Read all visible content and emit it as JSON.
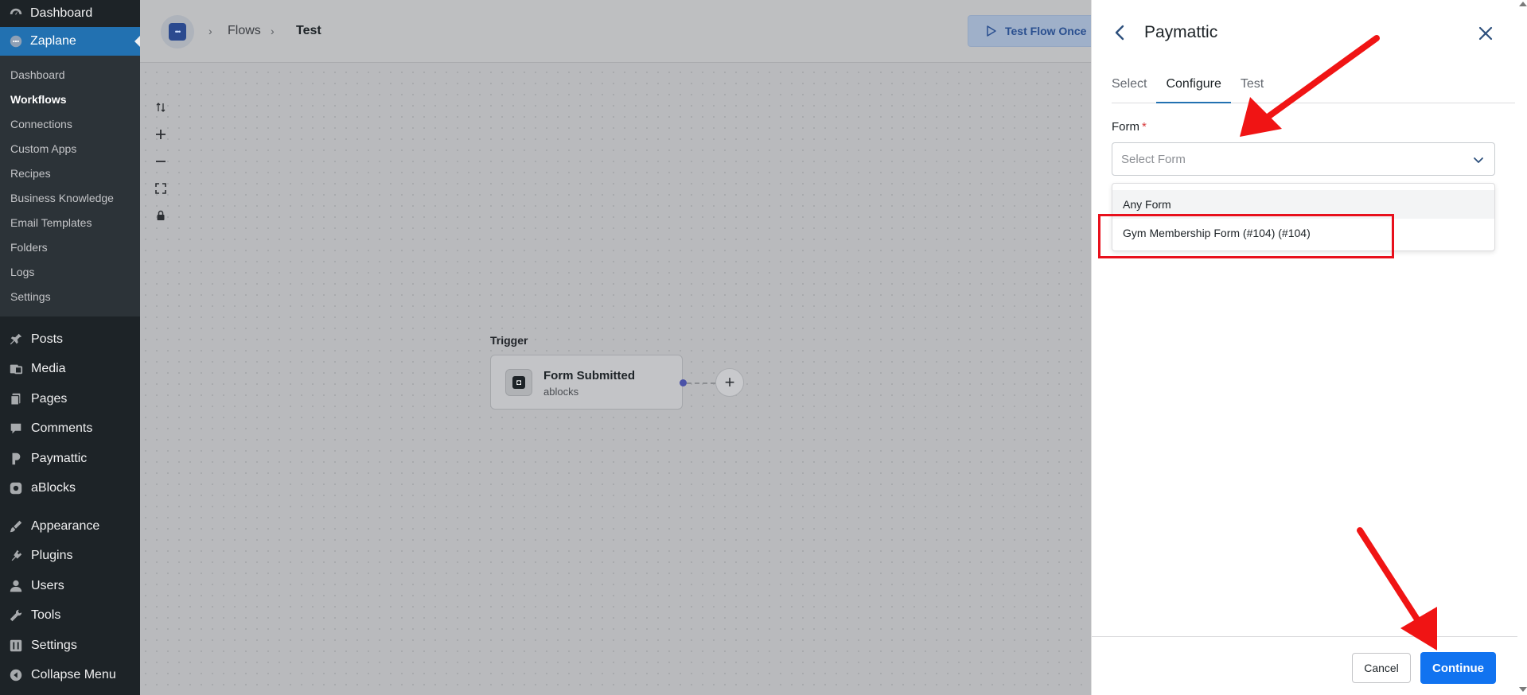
{
  "wp_sidebar": {
    "dashboard": "Dashboard",
    "current_plugin": "Zaplane",
    "submenu": [
      {
        "label": "Dashboard",
        "current": false
      },
      {
        "label": "Workflows",
        "current": true
      },
      {
        "label": "Connections",
        "current": false
      },
      {
        "label": "Custom Apps",
        "current": false
      },
      {
        "label": "Recipes",
        "current": false
      },
      {
        "label": "Business Knowledge",
        "current": false
      },
      {
        "label": "Email Templates",
        "current": false
      },
      {
        "label": "Folders",
        "current": false
      },
      {
        "label": "Logs",
        "current": false
      },
      {
        "label": "Settings",
        "current": false
      }
    ],
    "menu": [
      {
        "label": "Posts",
        "icon": "pin-icon"
      },
      {
        "label": "Media",
        "icon": "media-icon"
      },
      {
        "label": "Pages",
        "icon": "pages-icon"
      },
      {
        "label": "Comments",
        "icon": "comments-icon"
      },
      {
        "label": "Paymattic",
        "icon": "paymattic-icon"
      },
      {
        "label": "aBlocks",
        "icon": "ablocks-icon"
      },
      {
        "label": "Appearance",
        "icon": "appearance-icon"
      },
      {
        "label": "Plugins",
        "icon": "plugins-icon"
      },
      {
        "label": "Users",
        "icon": "users-icon"
      },
      {
        "label": "Tools",
        "icon": "tools-icon"
      },
      {
        "label": "Settings",
        "icon": "settings-icon"
      },
      {
        "label": "Collapse Menu",
        "icon": "collapse-icon"
      }
    ]
  },
  "topbar": {
    "breadcrumb_flows": "Flows",
    "breadcrumb_current": "Test",
    "test_flow_label": "Test Flow Once"
  },
  "canvas": {
    "trigger_label": "Trigger",
    "trigger_title": "Form Submitted",
    "trigger_subtitle": "ablocks"
  },
  "panel": {
    "title": "Paymattic",
    "tabs": [
      {
        "label": "Select",
        "active": false
      },
      {
        "label": "Configure",
        "active": true
      },
      {
        "label": "Test",
        "active": false
      }
    ],
    "form_label": "Form",
    "form_required_mark": "*",
    "form_placeholder": "Select Form",
    "form_options": [
      "Any Form",
      "Gym Membership Form (#104) (#104)"
    ],
    "cancel_label": "Cancel",
    "continue_label": "Continue"
  },
  "colors": {
    "wp_admin_bg": "#1d2327",
    "wp_accent": "#2271b1",
    "primary_button": "#1173f0",
    "annotation_red": "#e8101c"
  }
}
